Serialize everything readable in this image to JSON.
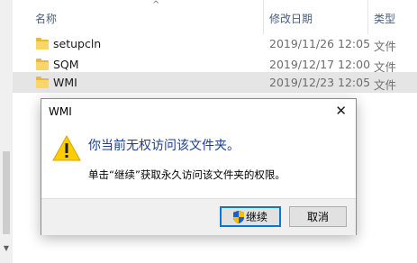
{
  "explorer": {
    "columns": {
      "name": "名称",
      "date_modified": "修改日期",
      "type": "类型"
    },
    "rows": [
      {
        "name": "setupcln",
        "date": "2019/11/26 12:05",
        "type": "文件夹",
        "selected": false
      },
      {
        "name": "SQM",
        "date": "2019/12/17 12:00",
        "type": "文件夹",
        "selected": false
      },
      {
        "name": "WMI",
        "date": "2019/12/23 12:05",
        "type": "文件夹",
        "selected": true
      }
    ],
    "row_types_visible": [
      "文件",
      "文件",
      "文件"
    ]
  },
  "dialog": {
    "title": "WMI",
    "close_glyph": "✕",
    "message": "你当前无权访问该文件夹。",
    "detail": "单击“继续”获取永久访问该文件夹的权限。",
    "continue_label": "继续",
    "cancel_label": "取消"
  },
  "colors": {
    "header_text": "#4c607a",
    "message_text": "#1d3f8f",
    "selected_row": "#e5e5e5",
    "warning_yellow": "#ffcc00"
  },
  "icons": {
    "folder": "folder-icon",
    "warning": "warning-icon",
    "uac_shield": "uac-shield-icon",
    "sort": "sort-up-icon"
  }
}
